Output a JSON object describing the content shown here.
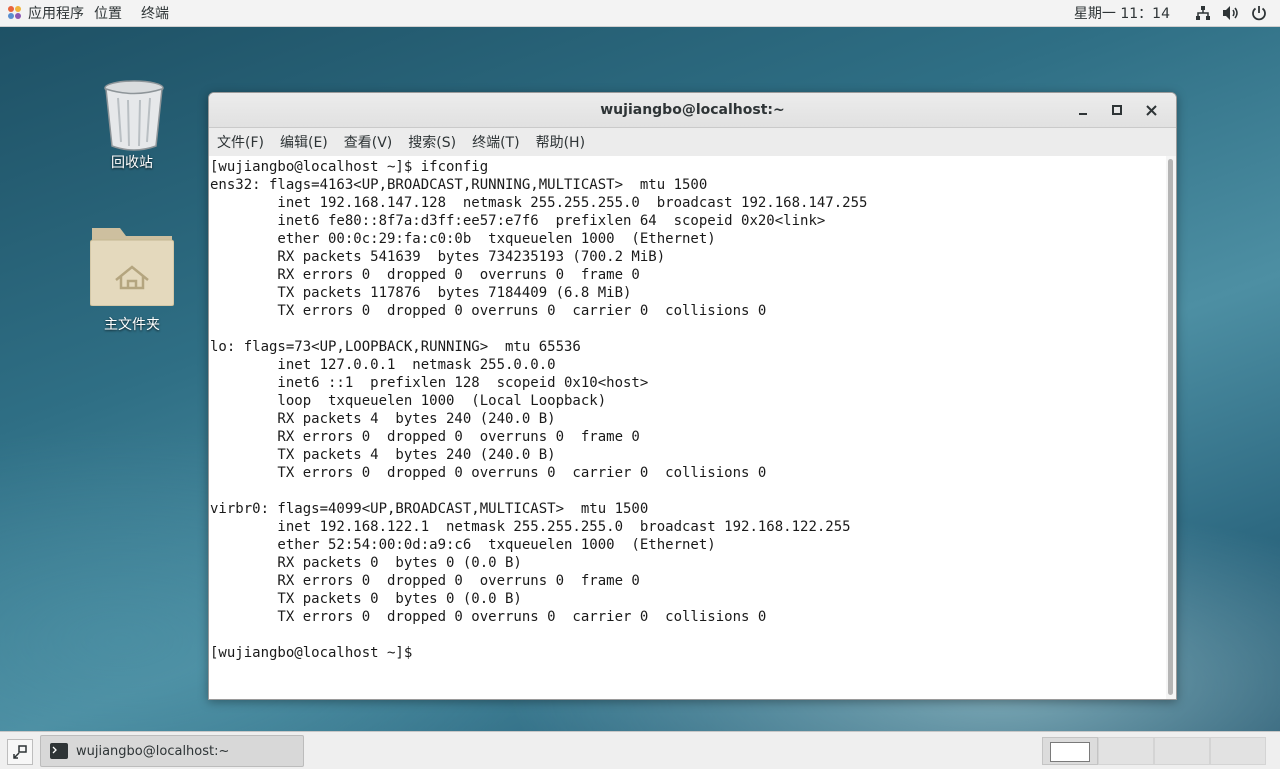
{
  "topbar": {
    "apps": "应用程序",
    "places": "位置",
    "terminal": "终端",
    "clock": "星期一 11：14",
    "icons": [
      "network-icon",
      "volume-icon",
      "power-icon"
    ]
  },
  "desktop": {
    "trash_label": "回收站",
    "home_label": "主文件夹"
  },
  "window": {
    "title": "wujiangbo@localhost:~",
    "controls": {
      "minimize": "–",
      "maximize": "□",
      "close": "✕"
    },
    "menu": [
      "文件(F)",
      "编辑(E)",
      "查看(V)",
      "搜索(S)",
      "终端(T)",
      "帮助(H)"
    ],
    "terminal_lines": [
      "[wujiangbo@localhost ~]$ ifconfig",
      "ens32: flags=4163<UP,BROADCAST,RUNNING,MULTICAST>  mtu 1500",
      "        inet 192.168.147.128  netmask 255.255.255.0  broadcast 192.168.147.255",
      "        inet6 fe80::8f7a:d3ff:ee57:e7f6  prefixlen 64  scopeid 0x20<link>",
      "        ether 00:0c:29:fa:c0:0b  txqueuelen 1000  (Ethernet)",
      "        RX packets 541639  bytes 734235193 (700.2 MiB)",
      "        RX errors 0  dropped 0  overruns 0  frame 0",
      "        TX packets 117876  bytes 7184409 (6.8 MiB)",
      "        TX errors 0  dropped 0 overruns 0  carrier 0  collisions 0",
      "",
      "lo: flags=73<UP,LOOPBACK,RUNNING>  mtu 65536",
      "        inet 127.0.0.1  netmask 255.0.0.0",
      "        inet6 ::1  prefixlen 128  scopeid 0x10<host>",
      "        loop  txqueuelen 1000  (Local Loopback)",
      "        RX packets 4  bytes 240 (240.0 B)",
      "        RX errors 0  dropped 0  overruns 0  frame 0",
      "        TX packets 4  bytes 240 (240.0 B)",
      "        TX errors 0  dropped 0 overruns 0  carrier 0  collisions 0",
      "",
      "virbr0: flags=4099<UP,BROADCAST,MULTICAST>  mtu 1500",
      "        inet 192.168.122.1  netmask 255.255.255.0  broadcast 192.168.122.255",
      "        ether 52:54:00:0d:a9:c6  txqueuelen 1000  (Ethernet)",
      "        RX packets 0  bytes 0 (0.0 B)",
      "        RX errors 0  dropped 0  overruns 0  frame 0",
      "        TX packets 0  bytes 0 (0.0 B)",
      "        TX errors 0  dropped 0 overruns 0  carrier 0  collisions 0",
      "",
      "[wujiangbo@localhost ~]$ "
    ]
  },
  "taskbar": {
    "task_label": "wujiangbo@localhost:~",
    "workspaces": 4,
    "active_workspace": 1
  }
}
